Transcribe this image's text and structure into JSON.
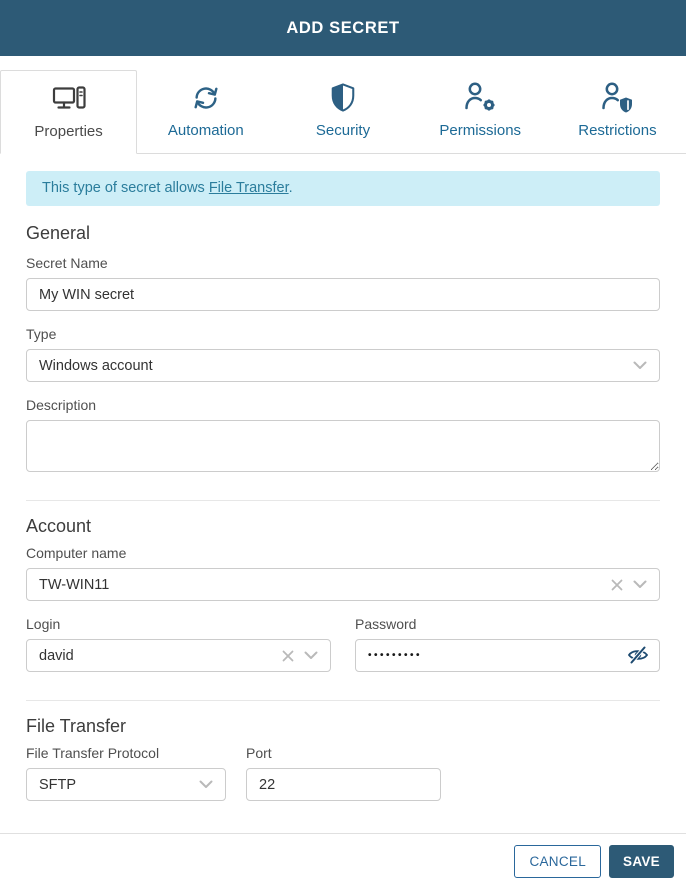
{
  "dialog": {
    "title": "ADD SECRET"
  },
  "tabs": [
    {
      "label": "Properties",
      "icon": "desktop-icon",
      "active": true
    },
    {
      "label": "Automation",
      "icon": "sync-icon",
      "active": false
    },
    {
      "label": "Security",
      "icon": "shield-icon",
      "active": false
    },
    {
      "label": "Permissions",
      "icon": "user-gear-icon",
      "active": false
    },
    {
      "label": "Restrictions",
      "icon": "user-shield-icon",
      "active": false
    }
  ],
  "banner": {
    "text_before": "This type of secret allows ",
    "link_label": "File Transfer",
    "text_after": "."
  },
  "form": {
    "general": {
      "heading": "General",
      "secret_name": {
        "label": "Secret Name",
        "value": "My WIN secret"
      },
      "type": {
        "label": "Type",
        "value": "Windows account"
      },
      "description": {
        "label": "Description",
        "value": ""
      }
    },
    "account": {
      "heading": "Account",
      "computer_name": {
        "label": "Computer name",
        "value": "TW-WIN11"
      },
      "login": {
        "label": "Login",
        "value": "david"
      },
      "password": {
        "label": "Password",
        "value": "•••••••••"
      }
    },
    "file_transfer": {
      "heading": "File Transfer",
      "protocol": {
        "label": "File Transfer Protocol",
        "value": "SFTP"
      },
      "port": {
        "label": "Port",
        "value": "22"
      }
    }
  },
  "footer": {
    "cancel_label": "CANCEL",
    "save_label": "SAVE"
  },
  "colors": {
    "header_bg": "#2d5a76",
    "tab_blue": "#1d6a96",
    "icon_blue": "#2d6286",
    "banner_bg": "#cdeef7",
    "banner_text": "#2b7d9c",
    "save_bg": "#2d5a76",
    "input_border": "#cccccc"
  }
}
